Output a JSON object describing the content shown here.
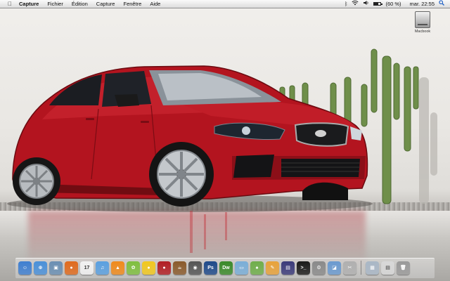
{
  "menubar": {
    "apple_icon": "apple-logo",
    "app_name": "Capture",
    "menus": [
      "Fichier",
      "Édition",
      "Capture",
      "Fenêtre",
      "Aide"
    ],
    "status": {
      "bluetooth_icon": "bluetooth-icon",
      "wifi_icon": "wifi-icon",
      "volume_icon": "volume-icon",
      "battery_percent_text": "(60 %)",
      "battery_level": 0.6,
      "clock": "mar. 22:55",
      "spotlight_icon": "spotlight-icon"
    }
  },
  "desktop": {
    "drive_label": "Macbook"
  },
  "dock": {
    "apps": [
      {
        "name": "finder",
        "icon": "finder-icon",
        "color": "#3f7fd1",
        "glyph": "☺"
      },
      {
        "name": "safari",
        "icon": "safari-icon",
        "color": "#4a90d9",
        "glyph": "⊕"
      },
      {
        "name": "preview",
        "icon": "preview-icon",
        "color": "#6a8fb3",
        "glyph": "▣"
      },
      {
        "name": "firefox",
        "icon": "firefox-icon",
        "color": "#e06a1d",
        "glyph": "●"
      },
      {
        "name": "ical",
        "icon": "calendar-icon",
        "color": "#f2f2f2",
        "glyph": "17"
      },
      {
        "name": "itunes",
        "icon": "itunes-icon",
        "color": "#5aa0e0",
        "glyph": "♫"
      },
      {
        "name": "vlc",
        "icon": "vlc-cone-icon",
        "color": "#f08a1c",
        "glyph": "▲"
      },
      {
        "name": "adium-duck",
        "icon": "duck-icon",
        "color": "#7fbf3f",
        "glyph": "✿"
      },
      {
        "name": "cyberduck",
        "icon": "rubber-duck-icon",
        "color": "#f2c81f",
        "glyph": "●"
      },
      {
        "name": "ladybug",
        "icon": "ladybug-icon",
        "color": "#b21e23",
        "glyph": "●"
      },
      {
        "name": "coffee",
        "icon": "coffee-cup-icon",
        "color": "#8a5a2b",
        "glyph": "☕"
      },
      {
        "name": "camera",
        "icon": "camera-icon",
        "color": "#555555",
        "glyph": "◉"
      },
      {
        "name": "photoshop",
        "icon": "photoshop-icon",
        "color": "#1f4a8a",
        "glyph": "Ps"
      },
      {
        "name": "dreamweaver",
        "icon": "dreamweaver-icon",
        "color": "#3a8a2a",
        "glyph": "Dw"
      },
      {
        "name": "folder-apps",
        "icon": "folder-icon",
        "color": "#7aaed8",
        "glyph": "▭"
      },
      {
        "name": "chair",
        "icon": "chair-icon",
        "color": "#6fae4a",
        "glyph": "♠"
      },
      {
        "name": "pencil-app",
        "icon": "pencil-icon",
        "color": "#e8a23a",
        "glyph": "✎"
      },
      {
        "name": "screen-app",
        "icon": "screen-icon",
        "color": "#3a3a7a",
        "glyph": "▤"
      },
      {
        "name": "terminal",
        "icon": "terminal-icon",
        "color": "#1a1a1a",
        "glyph": ">_"
      },
      {
        "name": "system-preferences",
        "icon": "gear-icon",
        "color": "#8a8a8a",
        "glyph": "⚙"
      },
      {
        "name": "iphoto",
        "icon": "photos-icon",
        "color": "#6a9ad0",
        "glyph": "◪"
      },
      {
        "name": "grab",
        "icon": "grab-icon",
        "color": "#b0b0b0",
        "glyph": "✂"
      }
    ],
    "right": [
      {
        "name": "applications-stack",
        "icon": "stack-folder-icon",
        "color": "#a9b7c6",
        "glyph": "▦"
      },
      {
        "name": "documents-stack",
        "icon": "documents-icon",
        "color": "#d8d8d8",
        "glyph": "▤"
      },
      {
        "name": "trash",
        "icon": "trash-icon",
        "color": "#9a9a9a",
        "glyph": "🗑"
      }
    ]
  }
}
